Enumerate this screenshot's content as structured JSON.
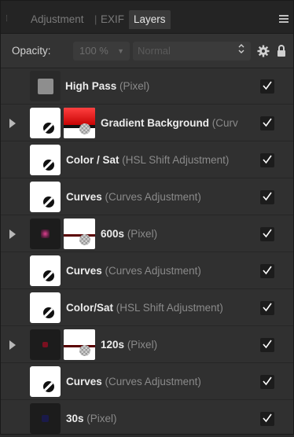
{
  "tabs": {
    "adjustment": "Adjustment",
    "sep": "|",
    "exif": "EXIF",
    "layers": "Layers"
  },
  "toolbar": {
    "opacity_label": "Opacity:",
    "opacity_value": "100 %",
    "opacity_caret": "▼",
    "blend_mode": "Normal",
    "blend_stepper": "⌃"
  },
  "colors": {
    "panel_bg": "#303030",
    "accent_red": "#d00000"
  },
  "layers": [
    {
      "name": "High Pass",
      "type": "(Pixel)",
      "visible": true,
      "expandable": false,
      "thumb": "gray-square"
    },
    {
      "name": "Gradient Background",
      "type": "(Curv",
      "visible": true,
      "expandable": true,
      "thumb": "adjustment-with-mask"
    },
    {
      "name": "Color / Sat",
      "type": "(HSL Shift Adjustment)",
      "visible": true,
      "expandable": false,
      "thumb": "adjustment"
    },
    {
      "name": "Curves",
      "type": "(Curves Adjustment)",
      "visible": true,
      "expandable": false,
      "thumb": "adjustment"
    },
    {
      "name": "600s",
      "type": "(Pixel)",
      "visible": true,
      "expandable": true,
      "thumb": "pixel-with-mask"
    },
    {
      "name": "Curves",
      "type": "(Curves Adjustment)",
      "visible": true,
      "expandable": false,
      "thumb": "adjustment"
    },
    {
      "name": "Color/Sat",
      "type": "(HSL Shift Adjustment)",
      "visible": true,
      "expandable": false,
      "thumb": "adjustment"
    },
    {
      "name": "120s",
      "type": "(Pixel)",
      "visible": true,
      "expandable": true,
      "thumb": "pixel-with-mask"
    },
    {
      "name": "Curves",
      "type": "(Curves Adjustment)",
      "visible": true,
      "expandable": false,
      "thumb": "adjustment"
    },
    {
      "name": "30s",
      "type": "(Pixel)",
      "visible": true,
      "expandable": false,
      "thumb": "pixel"
    }
  ]
}
